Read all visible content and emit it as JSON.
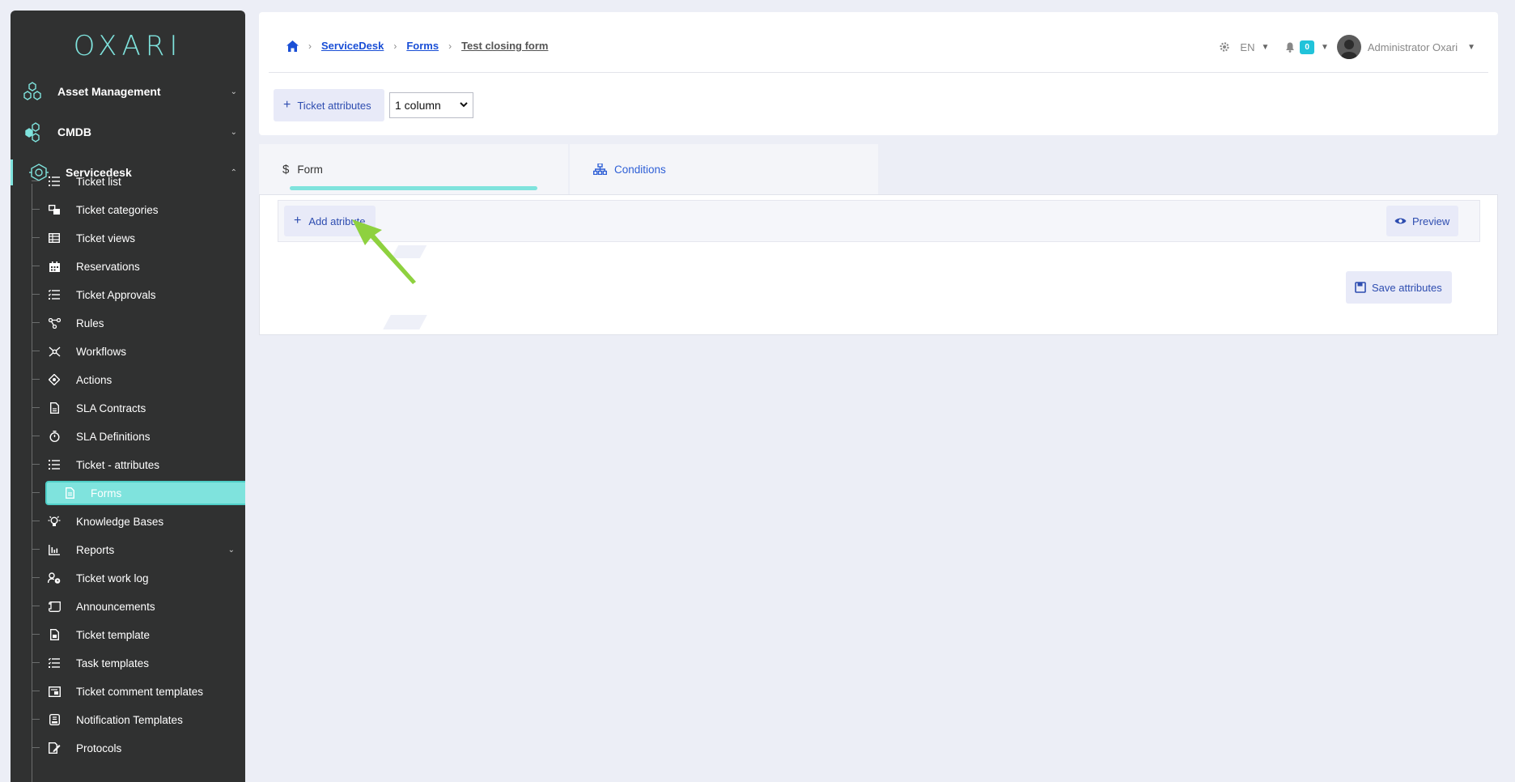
{
  "app": {
    "logo_text": "OXARI",
    "accent": "#7fe3dd"
  },
  "sidebar": {
    "sections": [
      {
        "label": "Asset Management",
        "icon": "hexagons-icon"
      },
      {
        "label": "CMDB",
        "icon": "hexagon-cluster-icon"
      },
      {
        "label": "Servicedesk",
        "icon": "servicedesk-icon"
      }
    ],
    "items": [
      {
        "label": "Ticket list",
        "icon": "list-icon"
      },
      {
        "label": "Ticket categories",
        "icon": "categories-icon"
      },
      {
        "label": "Ticket views",
        "icon": "table-icon"
      },
      {
        "label": "Reservations",
        "icon": "calendar-icon"
      },
      {
        "label": "Ticket Approvals",
        "icon": "checklist-icon"
      },
      {
        "label": "Rules",
        "icon": "rules-icon"
      },
      {
        "label": "Workflows",
        "icon": "workflow-icon"
      },
      {
        "label": "Actions",
        "icon": "actions-icon"
      },
      {
        "label": "SLA Contracts",
        "icon": "document-icon"
      },
      {
        "label": "SLA Definitions",
        "icon": "stopwatch-icon"
      },
      {
        "label": "Ticket - attributes",
        "icon": "list-icon"
      },
      {
        "label": "Forms",
        "icon": "form-icon"
      },
      {
        "label": "Knowledge Bases",
        "icon": "lightbulb-icon"
      },
      {
        "label": "Reports",
        "icon": "chart-icon"
      },
      {
        "label": "Ticket work log",
        "icon": "user-clock-icon"
      },
      {
        "label": "Announcements",
        "icon": "scroll-icon"
      },
      {
        "label": "Ticket template",
        "icon": "file-icon"
      },
      {
        "label": "Task templates",
        "icon": "checklist-icon"
      },
      {
        "label": "Ticket comment templates",
        "icon": "comment-template-icon"
      },
      {
        "label": "Notification Templates",
        "icon": "notification-template-icon"
      },
      {
        "label": "Protocols",
        "icon": "protocol-icon"
      }
    ]
  },
  "breadcrumb": {
    "home_icon": "home-icon",
    "links": [
      "ServiceDesk",
      "Forms"
    ],
    "current": "Test closing form"
  },
  "header": {
    "language": "EN",
    "notifications_count": "0",
    "user_name": "Administrator Oxari"
  },
  "toolbar": {
    "ticket_attributes_label": "Ticket attributes",
    "columns_selected": "1 column"
  },
  "tabs": [
    {
      "label": "Form",
      "icon": "dollar-icon"
    },
    {
      "label": "Conditions",
      "icon": "sitemap-icon"
    }
  ],
  "form": {
    "add_attribute_label": "Add atribute",
    "preview_label": "Preview",
    "save_label": "Save attributes"
  }
}
